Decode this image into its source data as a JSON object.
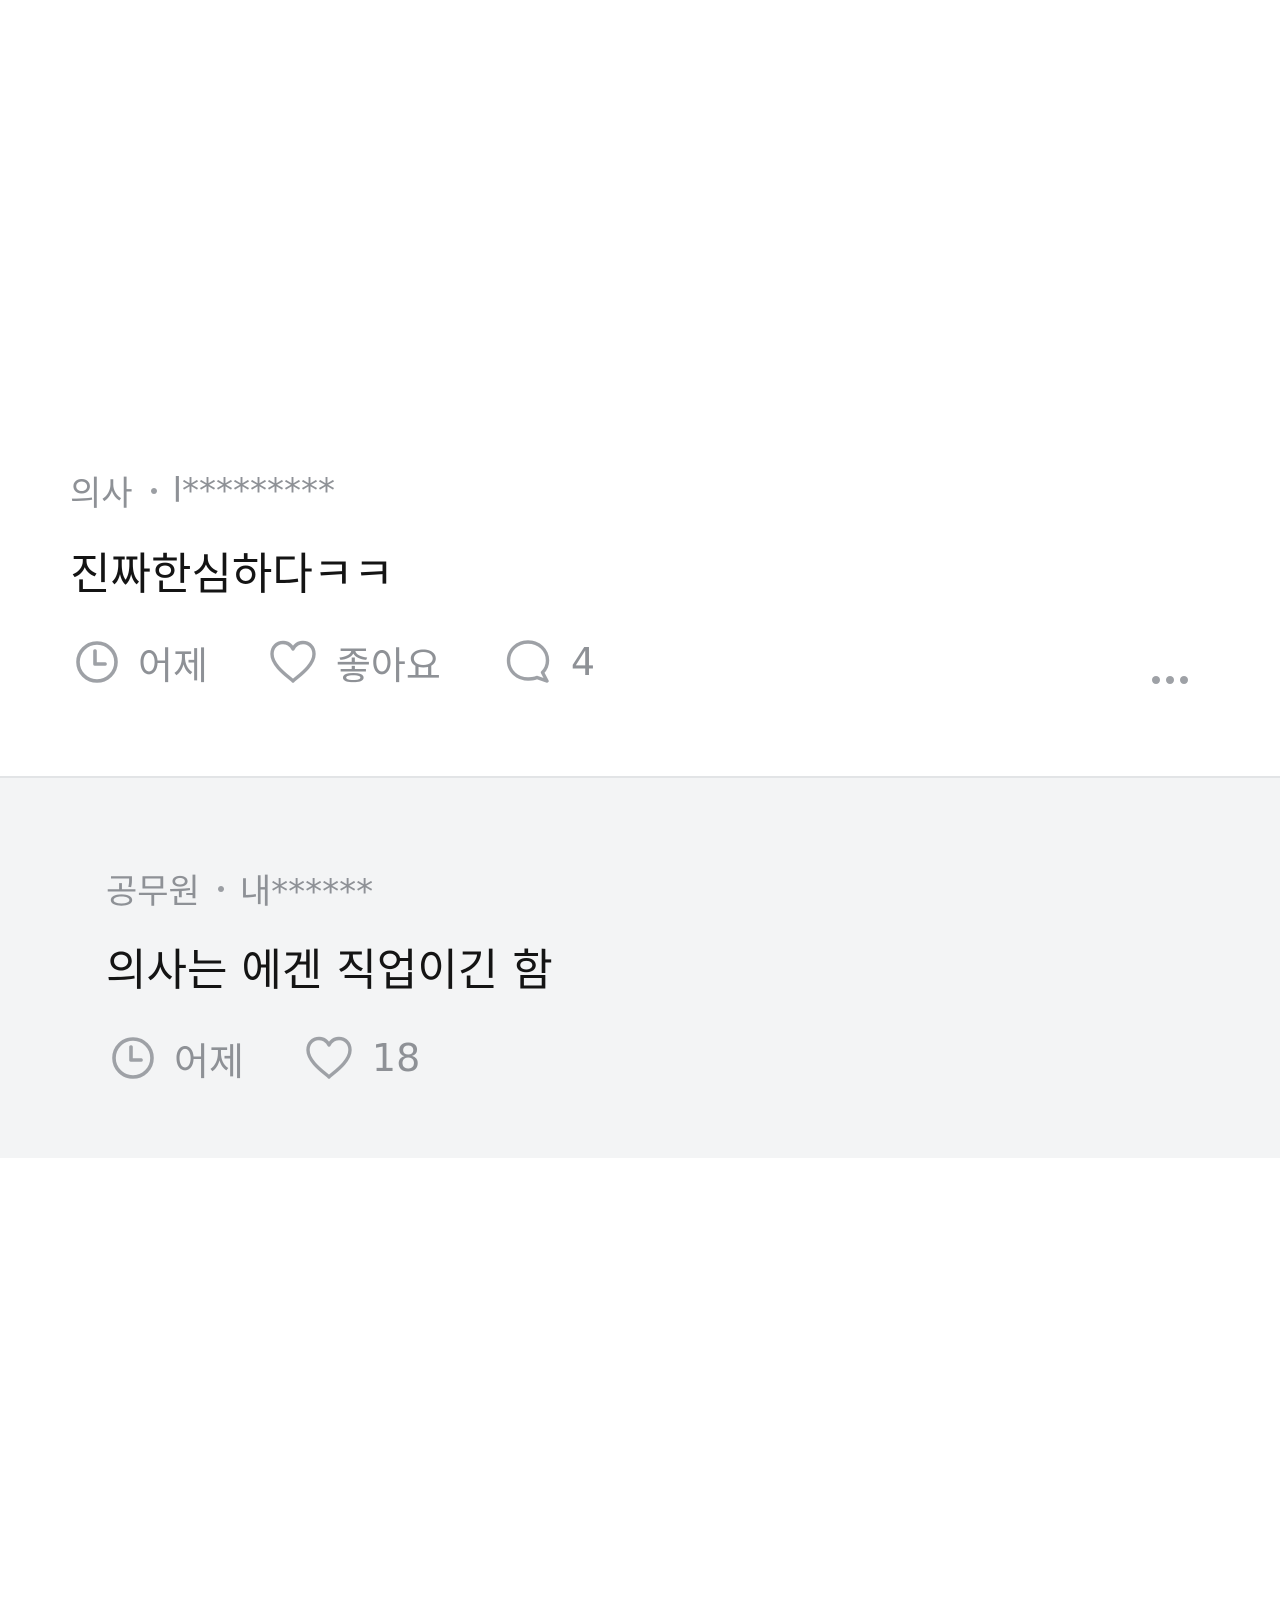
{
  "comments": [
    {
      "job": "의사",
      "author": "l*********",
      "text": "진짜한심하다ㅋㅋ",
      "time": "어제",
      "like_label": "좋아요",
      "reply_count": "4",
      "icons": [
        "clock-icon",
        "heart-icon",
        "comment-icon",
        "more-icon"
      ]
    },
    {
      "job": "공무원",
      "author": "내******",
      "text": "의사는 에겐 직업이긴 함",
      "time": "어제",
      "like_count": "18",
      "icons": [
        "clock-icon",
        "heart-icon"
      ]
    }
  ],
  "colors": {
    "meta_text": "#8e9196",
    "body_text": "#141414",
    "reply_background": "#f3f4f5",
    "divider": "#e2e4e6"
  }
}
